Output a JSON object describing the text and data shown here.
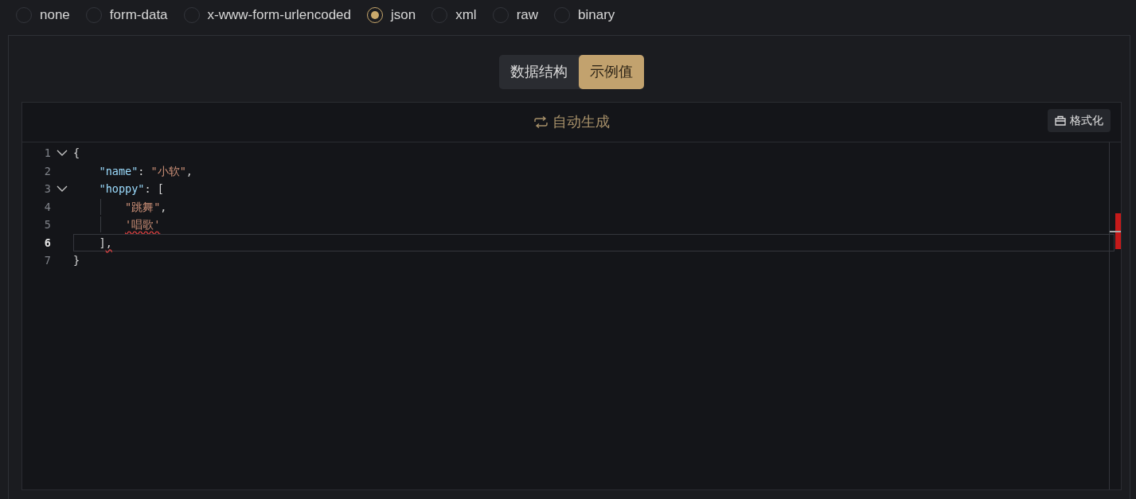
{
  "body_types": [
    {
      "label": "none",
      "selected": false
    },
    {
      "label": "form-data",
      "selected": false
    },
    {
      "label": "x-www-form-urlencoded",
      "selected": false
    },
    {
      "label": "json",
      "selected": true
    },
    {
      "label": "xml",
      "selected": false
    },
    {
      "label": "raw",
      "selected": false
    },
    {
      "label": "binary",
      "selected": false
    }
  ],
  "view_toggle": [
    {
      "label": "数据结构",
      "selected": false
    },
    {
      "label": "示例值",
      "selected": true
    }
  ],
  "editor": {
    "auto_generate": "自动生成",
    "format_button": "格式化",
    "lines": [
      {
        "number": "1",
        "foldable": true,
        "tokens": [
          {
            "kind": "punct",
            "text": "{"
          }
        ],
        "children": [
          {
            "number": "2",
            "tokens": [
              {
                "kind": "key",
                "text": "\"name\""
              },
              {
                "kind": "punct",
                "text": ":"
              },
              {
                "kind": "string",
                "text": "\"小软\""
              },
              {
                "kind": "punct",
                "text": ","
              }
            ]
          },
          {
            "number": "3",
            "foldable": true,
            "tokens": [
              {
                "kind": "key",
                "text": "\"hoppy\""
              },
              {
                "kind": "punct",
                "text": ": ["
              }
            ],
            "children": [
              {
                "number": "4",
                "tokens": [
                  {
                    "kind": "string",
                    "text": "\"跳舞\""
                  },
                  {
                    "kind": "punct",
                    "text": ","
                  }
                ]
              },
              {
                "number": "5",
                "tokens": [
                  {
                    "kind": "string",
                    "text": "'唱歌'",
                    "error": true
                  }
                ]
              }
            ]
          },
          {
            "number": "6",
            "current": true,
            "tokens": [
              {
                "kind": "punct",
                "text": "]"
              },
              {
                "kind": "punct",
                "text": ",",
                "error": true
              }
            ]
          }
        ]
      },
      {
        "number": "7",
        "tokens": [
          {
            "kind": "punct",
            "text": "}"
          }
        ]
      }
    ]
  }
}
